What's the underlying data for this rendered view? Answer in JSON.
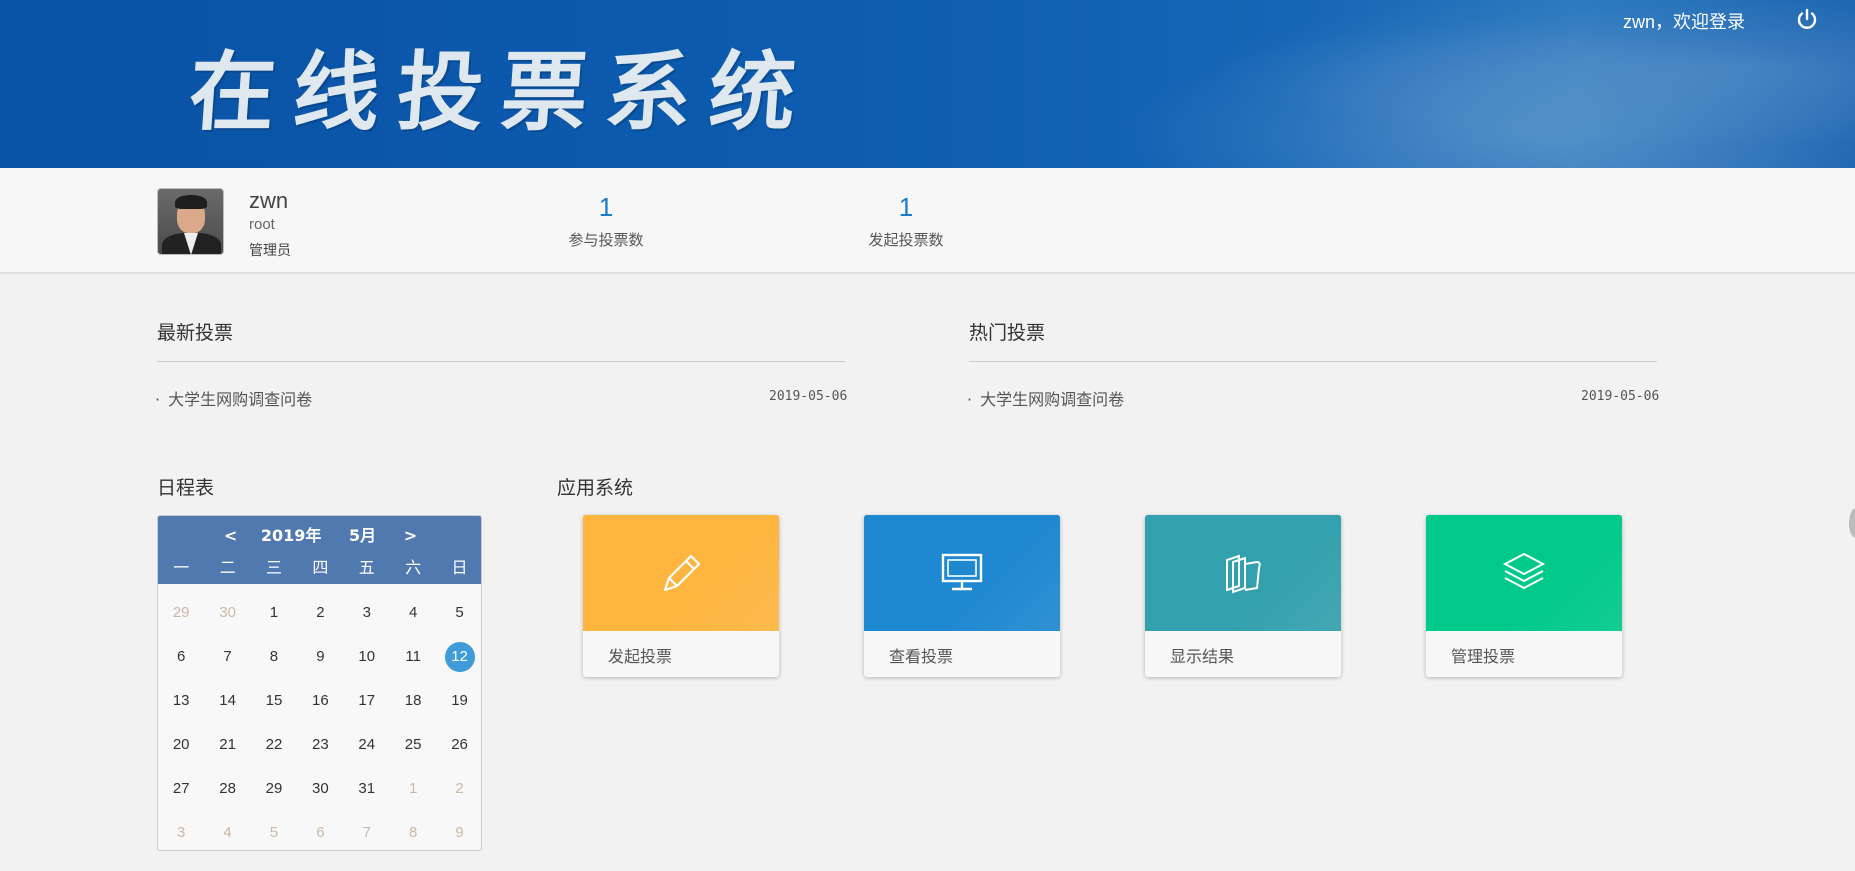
{
  "header": {
    "banner_title": "在线投票系统",
    "welcome_text": "zwn，欢迎登录",
    "logout_icon": "power-icon"
  },
  "profile": {
    "name": "zwn",
    "account": "root",
    "role": "管理员",
    "stats": [
      {
        "value": "1",
        "label": "参与投票数"
      },
      {
        "value": "1",
        "label": "发起投票数"
      }
    ]
  },
  "latest_votes": {
    "title": "最新投票",
    "items": [
      {
        "title": "大学生网购调查问卷",
        "date": "2019-05-06"
      }
    ]
  },
  "hot_votes": {
    "title": "热门投票",
    "items": [
      {
        "title": "大学生网购调查问卷",
        "date": "2019-05-06"
      }
    ]
  },
  "calendar": {
    "title": "日程表",
    "prev": "<",
    "next": ">",
    "year_label": "2019年",
    "month_label": "5月",
    "weekdays": [
      "一",
      "二",
      "三",
      "四",
      "五",
      "六",
      "日"
    ],
    "today": "12",
    "weeks": [
      [
        {
          "d": "29",
          "m": true
        },
        {
          "d": "30",
          "m": true
        },
        {
          "d": "1"
        },
        {
          "d": "2"
        },
        {
          "d": "3"
        },
        {
          "d": "4"
        },
        {
          "d": "5"
        }
      ],
      [
        {
          "d": "6"
        },
        {
          "d": "7"
        },
        {
          "d": "8"
        },
        {
          "d": "9"
        },
        {
          "d": "10"
        },
        {
          "d": "11"
        },
        {
          "d": "12"
        }
      ],
      [
        {
          "d": "13"
        },
        {
          "d": "14"
        },
        {
          "d": "15"
        },
        {
          "d": "16"
        },
        {
          "d": "17"
        },
        {
          "d": "18"
        },
        {
          "d": "19"
        }
      ],
      [
        {
          "d": "20"
        },
        {
          "d": "21"
        },
        {
          "d": "22"
        },
        {
          "d": "23"
        },
        {
          "d": "24"
        },
        {
          "d": "25"
        },
        {
          "d": "26"
        }
      ],
      [
        {
          "d": "27"
        },
        {
          "d": "28"
        },
        {
          "d": "29"
        },
        {
          "d": "30"
        },
        {
          "d": "31"
        },
        {
          "d": "1",
          "m": true
        },
        {
          "d": "2",
          "m": true
        }
      ],
      [
        {
          "d": "3",
          "m": true
        },
        {
          "d": "4",
          "m": true
        },
        {
          "d": "5",
          "m": true
        },
        {
          "d": "6",
          "m": true
        },
        {
          "d": "7",
          "m": true
        },
        {
          "d": "8",
          "m": true
        },
        {
          "d": "9",
          "m": true
        }
      ]
    ]
  },
  "apps": {
    "title": "应用系统",
    "items": [
      {
        "label": "发起投票",
        "icon": "pencil-icon",
        "color": "#fdb53f"
      },
      {
        "label": "查看投票",
        "icon": "monitor-icon",
        "color": "#1e88d0"
      },
      {
        "label": "显示结果",
        "icon": "books-icon",
        "color": "#33a0ad"
      },
      {
        "label": "管理投票",
        "icon": "layers-icon",
        "color": "#00c98a"
      }
    ]
  }
}
